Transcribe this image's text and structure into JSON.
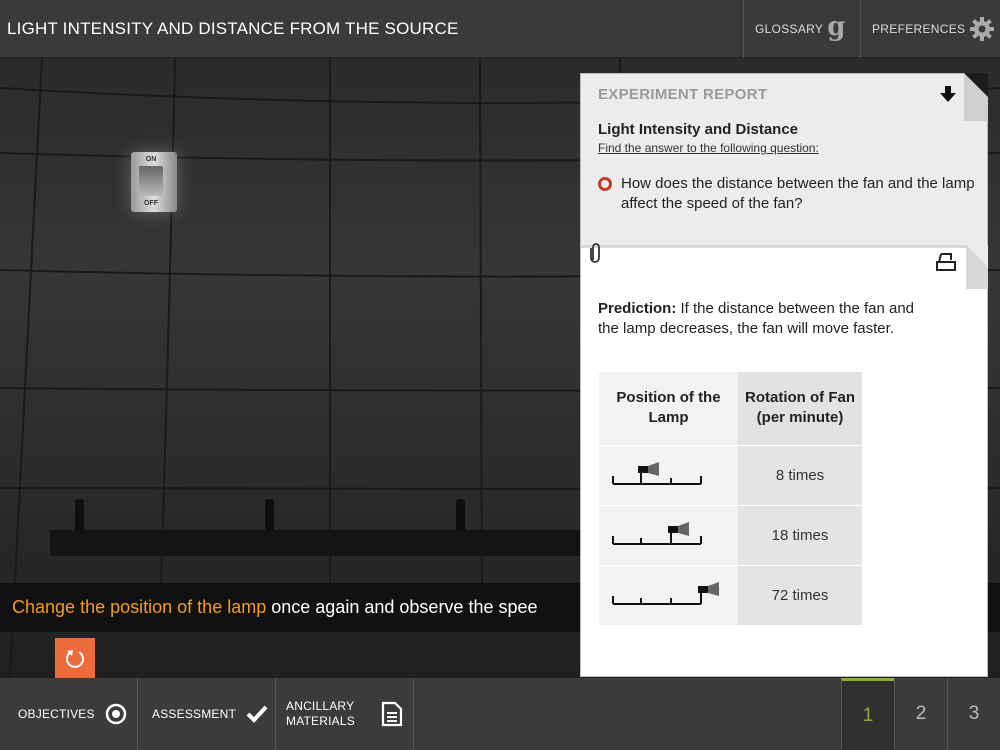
{
  "header": {
    "title": "LIGHT INTENSITY AND DISTANCE FROM THE SOURCE",
    "glossary_label": "GLOSSARY",
    "glossary_glyph": "g",
    "preferences_label": "PREFERENCES"
  },
  "scene": {
    "switch_on": "ON",
    "switch_off": "OFF",
    "instruction": {
      "seg1": "Change",
      "seg2": "the position",
      "seg3": "of the lamp",
      "seg4": "once again",
      "seg5": "and",
      "seg6": "observe",
      "seg7": "the spee"
    },
    "highlight_color": "#f39c1f"
  },
  "report": {
    "header": "EXPERIMENT REPORT",
    "subtitle": "Light Intensity and Distance",
    "find": "Find the answer to the following question:",
    "question": "How does the distance between the fan and the lamp affect the speed of the fan?",
    "prediction_label": "Prediction:",
    "prediction_text": "If the distance between the fan and the lamp decreases, the fan will move faster.",
    "table": {
      "col1": "Position of the Lamp",
      "col2": "Rotation of Fan (per minute)",
      "rows": [
        {
          "value": "8 times"
        },
        {
          "value": "18 times"
        },
        {
          "value": "72 times"
        }
      ]
    }
  },
  "footer": {
    "objectives": "OBJECTIVES",
    "assessment": "ASSESSMENT",
    "ancillary_1": "ANCILLARY",
    "ancillary_2": "MATERIALS",
    "pages": [
      "1",
      "2",
      "3"
    ],
    "active_page": "1",
    "active_color": "#8cae2a"
  }
}
